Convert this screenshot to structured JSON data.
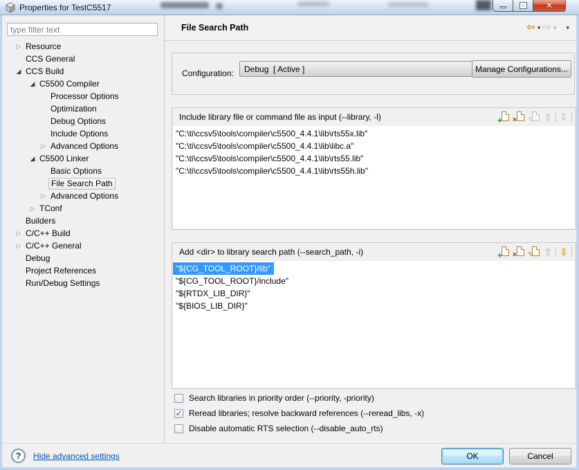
{
  "window": {
    "title": "Properties for TestC5517",
    "controls": [
      {
        "name": "minimize"
      },
      {
        "name": "maximize"
      },
      {
        "name": "close"
      }
    ]
  },
  "sidebar": {
    "filter_placeholder": "type filter text",
    "tree": [
      {
        "label": "Resource",
        "level": 0,
        "arrow": "collapsed",
        "selected": false
      },
      {
        "label": "CCS General",
        "level": 0,
        "arrow": "none",
        "selected": false
      },
      {
        "label": "CCS Build",
        "level": 0,
        "arrow": "expanded",
        "selected": false
      },
      {
        "label": "C5500 Compiler",
        "level": 1,
        "arrow": "expanded",
        "selected": false
      },
      {
        "label": "Processor Options",
        "level": 2,
        "arrow": "none",
        "selected": false
      },
      {
        "label": "Optimization",
        "level": 2,
        "arrow": "none",
        "selected": false
      },
      {
        "label": "Debug Options",
        "level": 2,
        "arrow": "none",
        "selected": false
      },
      {
        "label": "Include Options",
        "level": 2,
        "arrow": "none",
        "selected": false
      },
      {
        "label": "Advanced Options",
        "level": 2,
        "arrow": "collapsed",
        "selected": false
      },
      {
        "label": "C5500 Linker",
        "level": 1,
        "arrow": "expanded",
        "selected": false
      },
      {
        "label": "Basic Options",
        "level": 2,
        "arrow": "none",
        "selected": false
      },
      {
        "label": "File Search Path",
        "level": 2,
        "arrow": "none",
        "selected": true
      },
      {
        "label": "Advanced Options",
        "level": 2,
        "arrow": "collapsed",
        "selected": false
      },
      {
        "label": "TConf",
        "level": 1,
        "arrow": "collapsed",
        "selected": false
      },
      {
        "label": "Builders",
        "level": 0,
        "arrow": "none",
        "selected": false
      },
      {
        "label": "C/C++ Build",
        "level": 0,
        "arrow": "collapsed",
        "selected": false
      },
      {
        "label": "C/C++ General",
        "level": 0,
        "arrow": "collapsed",
        "selected": false
      },
      {
        "label": "Debug",
        "level": 0,
        "arrow": "none",
        "selected": false
      },
      {
        "label": "Project References",
        "level": 0,
        "arrow": "none",
        "selected": false
      },
      {
        "label": "Run/Debug Settings",
        "level": 0,
        "arrow": "none",
        "selected": false
      }
    ]
  },
  "header": {
    "title": "File Search Path",
    "nav_icons": [
      {
        "name": "back-arrow-icon",
        "glyph": "back",
        "color": "#c29a1a",
        "enabled": true
      },
      {
        "name": "back-dropdown-icon",
        "glyph": "dropdown",
        "color": "#3c3c3c",
        "enabled": true
      },
      {
        "name": "forward-arrow-icon",
        "glyph": "forward",
        "color": "#b9bec4",
        "enabled": false
      },
      {
        "name": "forward-dropdown-icon",
        "glyph": "dropdown",
        "color": "#a9aeb4",
        "enabled": false
      },
      {
        "name": "view-menu-icon",
        "glyph": "dropdown",
        "color": "#3c3c3c",
        "enabled": true
      }
    ]
  },
  "configuration": {
    "label": "Configuration:",
    "value": "Debug  [ Active ]",
    "manage_button": "Manage Configurations..."
  },
  "include_library": {
    "title": "Include library file or command file as input (--library, -l)",
    "actions": [
      {
        "name": "add",
        "enabled": true
      },
      {
        "name": "delete",
        "enabled": true
      },
      {
        "name": "edit",
        "enabled": false
      },
      {
        "name": "move-up",
        "enabled": false
      },
      {
        "name": "move-down",
        "enabled": false
      }
    ],
    "items": [
      "\"C:\\ti\\ccsv5\\tools\\compiler\\c5500_4.4.1\\lib\\rts55x.lib\"",
      "\"C:\\ti\\ccsv5\\tools\\compiler\\c5500_4.4.1\\lib\\libc.a\"",
      "\"C:\\ti\\ccsv5\\tools\\compiler\\c5500_4.4.1\\lib\\rts55.lib\"",
      "\"C:\\ti\\ccsv5\\tools\\compiler\\c5500_4.4.1\\lib\\rts55h.lib\""
    ],
    "selected_index": -1
  },
  "search_path": {
    "title": "Add <dir> to library search path (--search_path, -i)",
    "actions": [
      {
        "name": "add",
        "enabled": true
      },
      {
        "name": "delete",
        "enabled": true
      },
      {
        "name": "edit",
        "enabled": true
      },
      {
        "name": "move-up",
        "enabled": false
      },
      {
        "name": "move-down",
        "enabled": true
      }
    ],
    "items": [
      "\"${CG_TOOL_ROOT}/lib\"",
      "\"${CG_TOOL_ROOT}/include\"",
      "\"${RTDX_LIB_DIR}\"",
      "\"${BIOS_LIB_DIR}\""
    ],
    "selected_index": 0
  },
  "checkboxes": [
    {
      "label": "Search libraries in priority order (--priority, -priority)",
      "checked": false
    },
    {
      "label": "Reread libraries; resolve backward references (--reread_libs, -x)",
      "checked": true
    },
    {
      "label": "Disable automatic RTS selection (--disable_auto_rts)",
      "checked": false
    }
  ],
  "footer": {
    "help": "?",
    "link": "Hide advanced settings",
    "ok": "OK",
    "cancel": "Cancel"
  },
  "colors": {
    "selection": "#3399ff",
    "selection_text": "#ffffff",
    "link": "#0057ae",
    "check": "#1d5fae",
    "enabled_arrow": "#cfa018",
    "add_badge": "#1e9e1e",
    "delete_badge": "#cc1111",
    "edit_badge": "#b8860b"
  }
}
